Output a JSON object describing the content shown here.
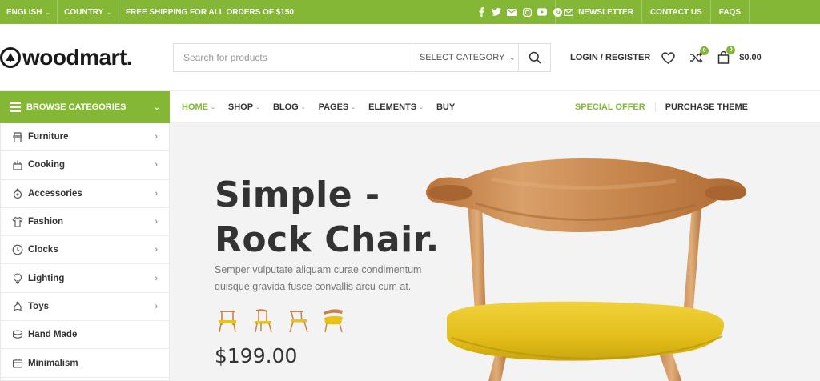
{
  "topbar": {
    "language": "ENGLISH",
    "country": "COUNTRY",
    "shipping": "FREE SHIPPING FOR ALL ORDERS OF $150",
    "social": [
      "facebook-icon",
      "twitter-icon",
      "email-icon",
      "instagram-icon",
      "youtube-icon",
      "pinterest-icon"
    ],
    "newsletter": "NEWSLETTER",
    "contact": "CONTACT US",
    "faqs": "FAQS"
  },
  "header": {
    "logo": "woodmart.",
    "search_placeholder": "Search for products",
    "search_category": "SELECT CATEGORY",
    "login": "LOGIN / REGISTER",
    "compare_count": "0",
    "cart_count": "0",
    "cart_total": "$0.00"
  },
  "nav": {
    "browse": "BROWSE CATEGORIES",
    "items": [
      "HOME",
      "SHOP",
      "BLOG",
      "PAGES",
      "ELEMENTS",
      "BUY"
    ],
    "special": "SPECIAL OFFER",
    "purchase": "PURCHASE THEME"
  },
  "categories": [
    {
      "label": "Furniture",
      "icon": "chair-icon"
    },
    {
      "label": "Cooking",
      "icon": "cooking-icon"
    },
    {
      "label": "Accessories",
      "icon": "accessories-icon"
    },
    {
      "label": "Fashion",
      "icon": "shirt-icon"
    },
    {
      "label": "Clocks",
      "icon": "clock-icon"
    },
    {
      "label": "Lighting",
      "icon": "bulb-icon"
    },
    {
      "label": "Toys",
      "icon": "toy-icon"
    },
    {
      "label": "Hand Made",
      "icon": "handmade-icon"
    },
    {
      "label": "Minimalism",
      "icon": "minimalism-icon"
    }
  ],
  "hero": {
    "title_line1": "Simple -",
    "title_line2": "Rock Chair.",
    "description": "Semper vulputate aliquam curae condimentum quisque gravida fusce convallis arcu cum at.",
    "price": "$199.00"
  },
  "colors": {
    "accent": "#83b735"
  }
}
